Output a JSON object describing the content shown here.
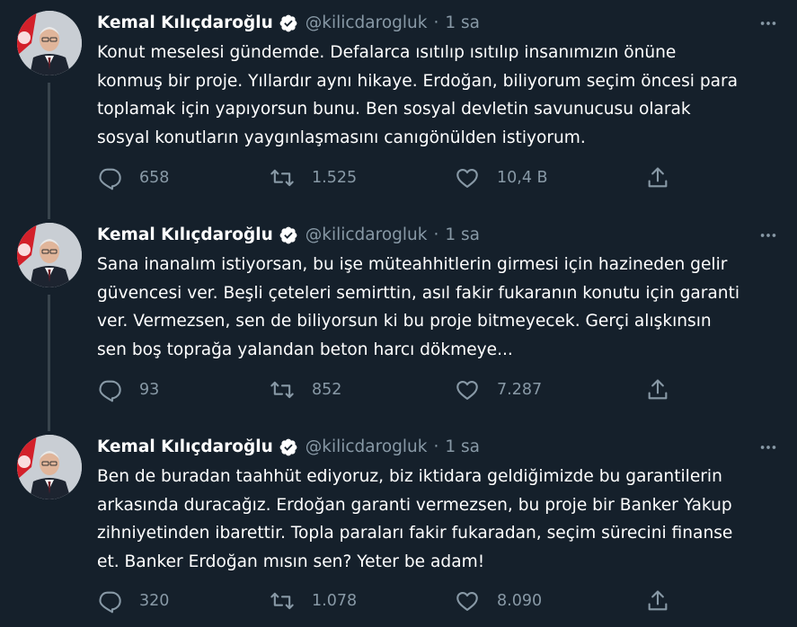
{
  "tweets": [
    {
      "name": "Kemal Kılıçdaroğlu",
      "handle": "@kilicdarogluk",
      "separator": "·",
      "time": "1 sa",
      "text": "Konut meselesi gündemde. Defalarca ısıtılıp ısıtılıp insanımızın önüne\nkonmuş bir proje. Yıllardır aynı hikaye. Erdoğan, biliyorum seçim öncesi para\ntoplamak için yapıyorsun bunu. Ben sosyal devletin savunucusu olarak\nsosyal konutların yaygınlaşmasını canıgönülden istiyorum.",
      "replies": "658",
      "retweets": "1.525",
      "likes": "10,4 B"
    },
    {
      "name": "Kemal Kılıçdaroğlu",
      "handle": "@kilicdarogluk",
      "separator": "·",
      "time": "1 sa",
      "text": "Sana inanalım istiyorsan, bu işe müteahhitlerin girmesi için hazineden gelir\ngüvencesi ver. Beşli çeteleri semirttin, asıl fakir fukaranın konutu için garanti\nver. Vermezsen, sen de biliyorsun ki bu proje bitmeyecek. Gerçi alışkınsın\nsen boş toprağa yalandan beton harcı dökmeye...",
      "replies": "93",
      "retweets": "852",
      "likes": "7.287"
    },
    {
      "name": "Kemal Kılıçdaroğlu",
      "handle": "@kilicdarogluk",
      "separator": "·",
      "time": "1 sa",
      "text": "Ben de buradan taahhüt ediyoruz, biz iktidara geldiğimizde bu garantilerin\narkasında duracağız. Erdoğan garanti vermezsen, bu proje bir Banker Yakup\nzihniyetinden ibarettir. Topla paraları fakir fukaradan, seçim sürecini finanse\net. Banker Erdoğan mısın sen? Yeter be adam!",
      "replies": "320",
      "retweets": "1.078",
      "likes": "8.090"
    }
  ],
  "icons": {
    "verified": "verified-badge-icon",
    "more": "more-options-icon",
    "reply": "reply-icon",
    "retweet": "retweet-icon",
    "like": "like-icon",
    "share": "share-icon"
  },
  "colors": {
    "background": "#15202b",
    "text_primary": "#ffffff",
    "text_secondary": "#8899a6",
    "thread_line": "#38444d",
    "verified_badge": "#ffffff"
  }
}
